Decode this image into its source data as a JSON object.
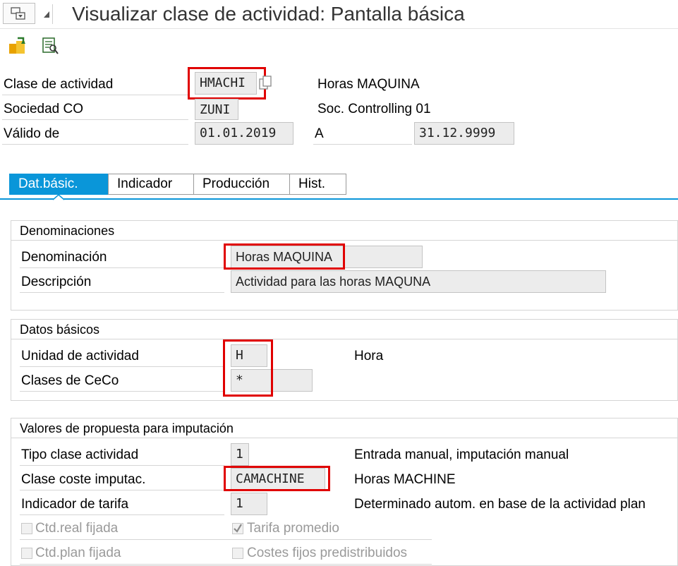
{
  "title": "Visualizar clase de actividad: Pantalla básica",
  "header_fields": {
    "clase_actividad": {
      "label": "Clase de actividad",
      "value": "HMACHI",
      "desc": "Horas MAQUINA"
    },
    "sociedad_co": {
      "label": "Sociedad CO",
      "value": "ZUNI",
      "desc": "Soc. Controlling 01"
    },
    "valido_de": {
      "label": "Válido de",
      "value": "01.01.2019"
    },
    "valido_a": {
      "label": "A",
      "value": "31.12.9999"
    }
  },
  "tabs": [
    "Dat.básic.",
    "Indicador",
    "Producción",
    "Hist."
  ],
  "denominaciones": {
    "title": "Denominaciones",
    "denominacion": {
      "label": "Denominación",
      "value": "Horas MAQUINA"
    },
    "descripcion": {
      "label": "Descripción",
      "value": "Actividad para las horas MAQUNA"
    }
  },
  "datos_basicos": {
    "title": "Datos básicos",
    "unidad": {
      "label": "Unidad de actividad",
      "value": "H",
      "desc": "Hora"
    },
    "clases_ceco": {
      "label": "Clases de CeCo",
      "value": "*"
    }
  },
  "valores_propuesta": {
    "title": "Valores de propuesta para imputación",
    "tipo_clase": {
      "label": "Tipo clase actividad",
      "value": "1",
      "desc": "Entrada manual, imputación manual"
    },
    "clase_coste": {
      "label": "Clase coste imputac.",
      "value": "CAMACHINE",
      "desc": "Horas MACHINE"
    },
    "indicador_tarifa": {
      "label": "Indicador de tarifa",
      "value": "1",
      "desc": "Determinado autom. en base de la actividad plan"
    },
    "ctd_real": {
      "label": "Ctd.real fijada",
      "checked": false
    },
    "tarifa_promedio": {
      "label": "Tarifa promedio",
      "checked": true
    },
    "ctd_plan": {
      "label": "Ctd.plan fijada",
      "checked": false
    },
    "costes_fijos": {
      "label": "Costes fijos predistribuidos",
      "checked": false
    }
  },
  "colors": {
    "accent": "#0a96d9",
    "highlight": "#e00000"
  }
}
